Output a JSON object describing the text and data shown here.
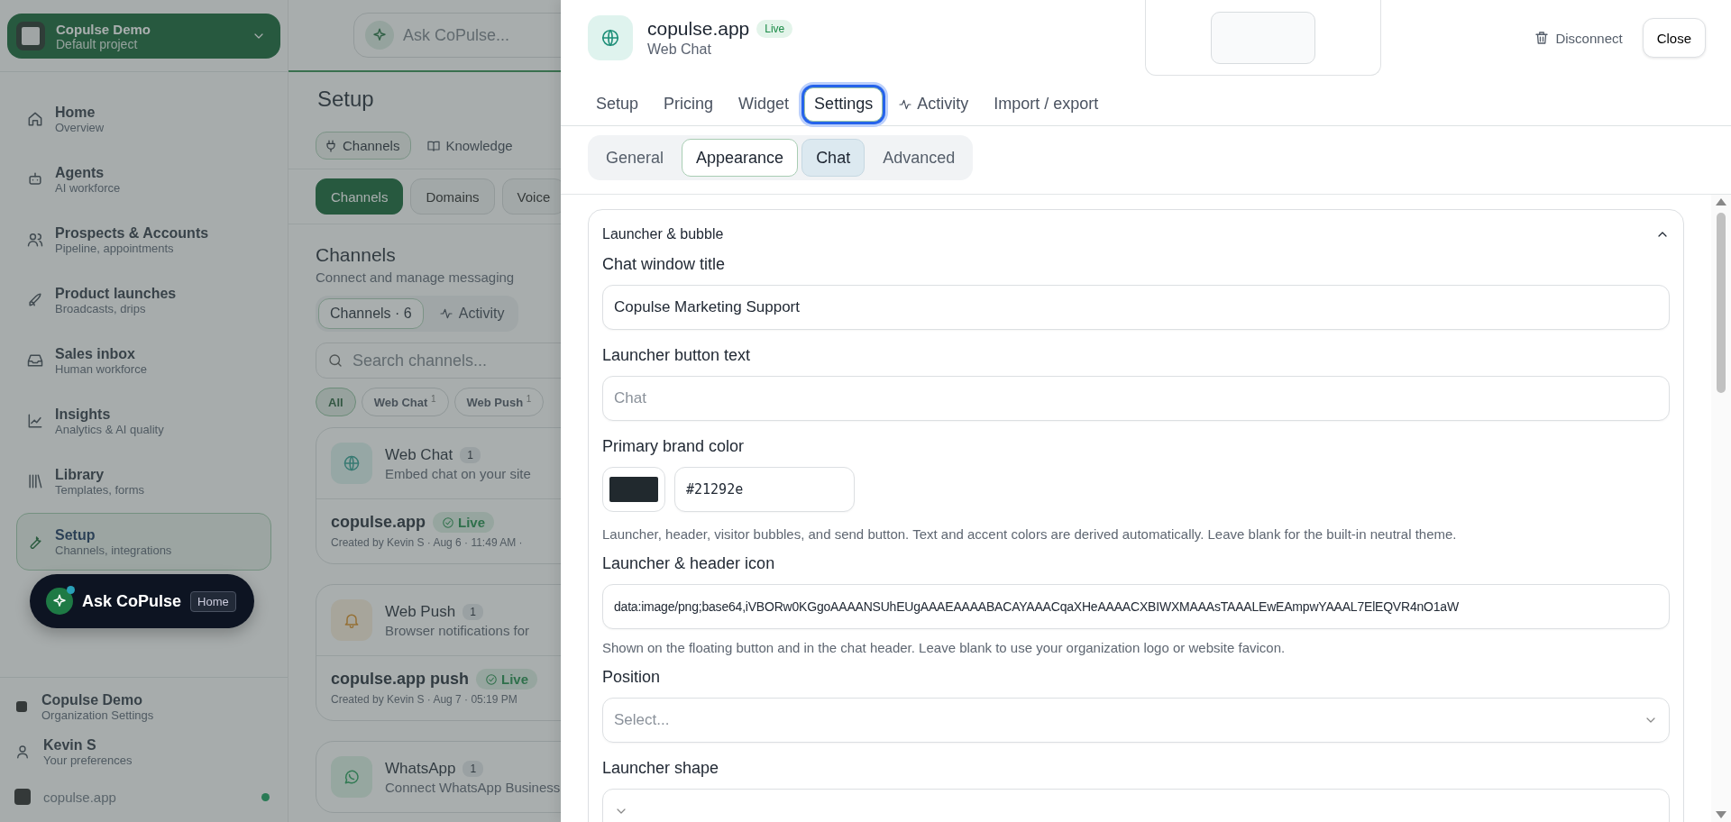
{
  "sidebar": {
    "project": {
      "name": "Copulse Demo",
      "subtitle": "Default project"
    },
    "items": [
      {
        "label": "Home",
        "subtitle": "Overview",
        "selected": false
      },
      {
        "label": "Agents",
        "subtitle": "AI workforce",
        "selected": false
      },
      {
        "label": "Prospects & Accounts",
        "subtitle": "Pipeline, appointments",
        "selected": false
      },
      {
        "label": "Product launches",
        "subtitle": "Broadcasts, drips",
        "selected": false
      },
      {
        "label": "Sales inbox",
        "subtitle": "Human workforce",
        "selected": false
      },
      {
        "label": "Insights",
        "subtitle": "Analytics & AI quality",
        "selected": false
      },
      {
        "label": "Library",
        "subtitle": "Templates, forms",
        "selected": false
      },
      {
        "label": "Setup",
        "subtitle": "Channels, integrations",
        "selected": true
      }
    ],
    "ask_button": {
      "label": "Ask CoPulse",
      "badge": "Home"
    },
    "footer": [
      {
        "kind": "org",
        "label": "Copulse Demo",
        "subtitle": "Organization Settings"
      },
      {
        "kind": "user",
        "label": "Kevin S",
        "subtitle": "Your preferences"
      },
      {
        "kind": "site",
        "label": "copulse.app",
        "online": true
      }
    ]
  },
  "main": {
    "ask_placeholder": "Ask CoPulse...",
    "title": "Setup",
    "section_tabs": [
      {
        "label": "Channels",
        "selected": true
      },
      {
        "label": "Knowledge",
        "selected": false
      }
    ],
    "pills": [
      {
        "label": "Channels",
        "selected": true
      },
      {
        "label": "Domains",
        "selected": false
      },
      {
        "label": "Voice",
        "selected": false
      }
    ],
    "heading": "Channels",
    "description": "Connect and manage messaging",
    "view_tabs": [
      {
        "label": "Channels · 6",
        "selected": true
      },
      {
        "label": "Activity",
        "selected": false
      }
    ],
    "search_placeholder": "Search channels...",
    "filters": [
      {
        "label": "All",
        "selected": true
      },
      {
        "label": "Web Chat",
        "count": "1",
        "selected": false
      },
      {
        "label": "Web Push",
        "count": "1",
        "selected": false
      }
    ],
    "groups": [
      {
        "kind": "web_chat",
        "name": "Web Chat",
        "count": "1",
        "description": "Embed chat on your site",
        "entries": [
          {
            "name": "copulse.app",
            "status": "Live",
            "meta": "Created by Kevin S · Aug 6 · 11:49 AM ·"
          }
        ]
      },
      {
        "kind": "web_push",
        "name": "Web Push",
        "count": "1",
        "description": "Browser notifications for",
        "entries": [
          {
            "name": "copulse.app push",
            "status": "Live",
            "meta": "Created by Kevin S · Aug 7 · 05:19 PM"
          }
        ]
      },
      {
        "kind": "whatsapp",
        "name": "WhatsApp",
        "count": "1",
        "description": "Connect WhatsApp Business"
      }
    ]
  },
  "drawer": {
    "title": "copulse.app",
    "status": "Live",
    "subtitle": "Web Chat",
    "disconnect": "Disconnect",
    "close": "Close",
    "tabs": [
      {
        "label": "Setup",
        "selected": false,
        "focused": false
      },
      {
        "label": "Pricing",
        "selected": false,
        "focused": false
      },
      {
        "label": "Widget",
        "selected": false,
        "focused": false
      },
      {
        "label": "Settings",
        "selected": true,
        "focused": true
      },
      {
        "label": "Activity",
        "selected": false,
        "focused": false
      },
      {
        "label": "Import / export",
        "selected": false,
        "focused": false
      }
    ],
    "subtabs": [
      {
        "label": "General",
        "selected": false,
        "highlighted": false
      },
      {
        "label": "Appearance",
        "selected": true,
        "highlighted": false
      },
      {
        "label": "Chat",
        "selected": false,
        "highlighted": true
      },
      {
        "label": "Advanced",
        "selected": false,
        "highlighted": false
      }
    ],
    "section": {
      "title": "Launcher & bubble",
      "expanded": true,
      "fields": [
        {
          "kind": "text",
          "label": "Chat window title",
          "value": "Copulse Marketing Support"
        },
        {
          "kind": "text",
          "label": "Launcher button text",
          "placeholder": "Chat"
        },
        {
          "kind": "color",
          "label": "Primary brand color",
          "value": "#21292e",
          "help": "Launcher, header, visitor bubbles, and send button. Text and accent colors are derived automatically. Leave blank for the built-in neutral theme."
        },
        {
          "kind": "text",
          "label": "Launcher & header icon",
          "value": "data:image/png;base64,iVBORw0KGgoAAAANSUhEUgAAAEAAAABACAYAAACqaXHeAAAACXBIWXMAAAsTAAALEwEAmpwYAAAL7ElEQVR4nO1aW",
          "help": "Shown on the floating button and in the chat header. Leave blank to use your organization logo or website favicon."
        },
        {
          "kind": "select",
          "label": "Position",
          "placeholder": "Select..."
        },
        {
          "kind": "select",
          "label": "Launcher shape"
        }
      ]
    }
  }
}
